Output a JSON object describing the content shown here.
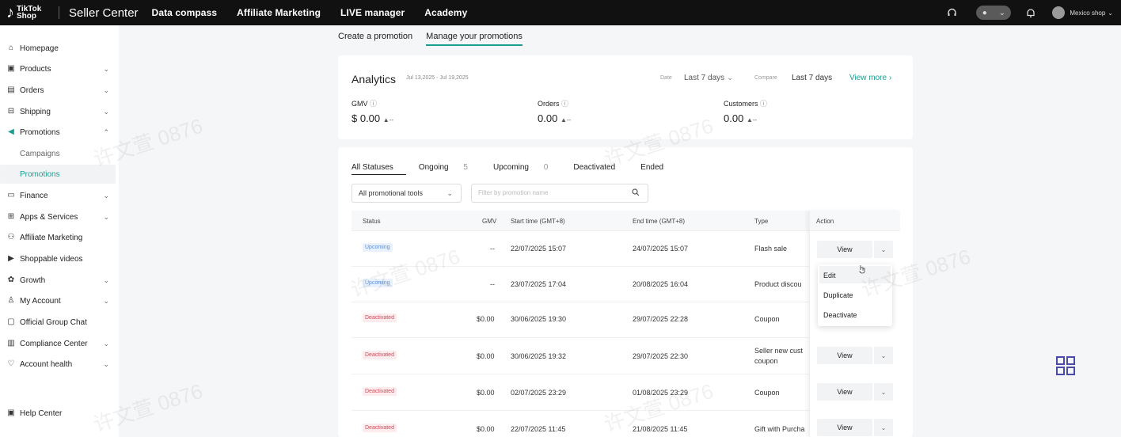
{
  "topbar": {
    "logo_line1": "TikTok",
    "logo_line2": "Shop",
    "brand": "Seller Center",
    "nav": [
      "Data compass",
      "Affiliate Marketing",
      "LIVE manager",
      "Academy"
    ],
    "shop_name": "Mexico shop"
  },
  "sidebar": {
    "items": [
      {
        "label": "Homepage",
        "icon": "home-icon",
        "chevron": ""
      },
      {
        "label": "Products",
        "icon": "box-icon",
        "chevron": "⌄"
      },
      {
        "label": "Orders",
        "icon": "clipboard-icon",
        "chevron": "⌄"
      },
      {
        "label": "Shipping",
        "icon": "truck-icon",
        "chevron": "⌄"
      },
      {
        "label": "Promotions",
        "icon": "megaphone-icon",
        "chevron": "⌃"
      },
      {
        "label": "Campaigns",
        "icon": "",
        "chevron": ""
      },
      {
        "label": "Promotions",
        "icon": "",
        "chevron": ""
      },
      {
        "label": "Finance",
        "icon": "wallet-icon",
        "chevron": "⌄"
      },
      {
        "label": "Apps & Services",
        "icon": "apps-icon",
        "chevron": "⌄"
      },
      {
        "label": "Affiliate Marketing",
        "icon": "people-icon",
        "chevron": ""
      },
      {
        "label": "Shoppable videos",
        "icon": "video-icon",
        "chevron": ""
      },
      {
        "label": "Growth",
        "icon": "growth-icon",
        "chevron": "⌄"
      },
      {
        "label": "My Account",
        "icon": "user-icon",
        "chevron": "⌄"
      },
      {
        "label": "Official Group Chat",
        "icon": "chat-icon",
        "chevron": ""
      },
      {
        "label": "Compliance Center",
        "icon": "compliance-icon",
        "chevron": "⌄"
      },
      {
        "label": "Account health",
        "icon": "health-icon",
        "chevron": "⌄"
      }
    ],
    "help": "Help Center"
  },
  "page_tabs": [
    "Create a promotion",
    "Manage your promotions"
  ],
  "analytics": {
    "title": "Analytics",
    "range": "Jul 13,2025 - Jul 19,2025",
    "date_label": "Date",
    "date_value": "Last 7 days",
    "compare_label": "Compare",
    "compare_value": "Last 7 days",
    "view_more": "View more",
    "metrics": [
      {
        "label": "GMV",
        "value": "$ 0.00",
        "trend": "▲--"
      },
      {
        "label": "Orders",
        "value": "0.00",
        "trend": "▲--"
      },
      {
        "label": "Customers",
        "value": "0.00",
        "trend": "▲--"
      }
    ]
  },
  "status_tabs": [
    {
      "label": "All Statuses",
      "count": ""
    },
    {
      "label": "Ongoing",
      "count": "5"
    },
    {
      "label": "Upcoming",
      "count": "0"
    },
    {
      "label": "Deactivated",
      "count": ""
    },
    {
      "label": "Ended",
      "count": ""
    }
  ],
  "filters": {
    "tool_select": "All promotional tools",
    "search_placeholder": "Filter by promotion name"
  },
  "table": {
    "headers": {
      "status": "Status",
      "gmv": "GMV",
      "start": "Start time (GMT+8)",
      "end": "End time (GMT+8)",
      "type": "Type",
      "action": "Action"
    },
    "rows": [
      {
        "status": "Upcoming",
        "gmv": "--",
        "start": "22/07/2025 15:07",
        "end": "24/07/2025 15:07",
        "type": "Flash sale",
        "type2": "",
        "view": "View"
      },
      {
        "status": "Upcoming",
        "gmv": "--",
        "start": "23/07/2025 17:04",
        "end": "20/08/2025 16:04",
        "type": "Product discou",
        "type2": "",
        "view": ""
      },
      {
        "status": "Deactivated",
        "gmv": "$0.00",
        "start": "30/06/2025 19:30",
        "end": "29/07/2025 22:28",
        "type": "Coupon",
        "type2": "",
        "view": ""
      },
      {
        "status": "Deactivated",
        "gmv": "$0.00",
        "start": "30/06/2025 19:32",
        "end": "29/07/2025 22:30",
        "type": "Seller new cust",
        "type2": "coupon",
        "view": "View"
      },
      {
        "status": "Deactivated",
        "gmv": "$0.00",
        "start": "02/07/2025 23:29",
        "end": "01/08/2025 23:29",
        "type": "Coupon",
        "type2": "",
        "view": "View"
      },
      {
        "status": "Deactivated",
        "gmv": "$0.00",
        "start": "22/07/2025 11:45",
        "end": "21/08/2025 11:45",
        "type": "Gift with Purcha",
        "type2": "",
        "view": "View"
      }
    ]
  },
  "dropdown": [
    "Edit",
    "Duplicate",
    "Deactivate"
  ],
  "watermark": "许文萱 0876",
  "colors": {
    "accent": "#1a9e8f",
    "topbar": "#111111",
    "upcoming": "#5b8fd6",
    "deactivated": "#d04b5a"
  }
}
